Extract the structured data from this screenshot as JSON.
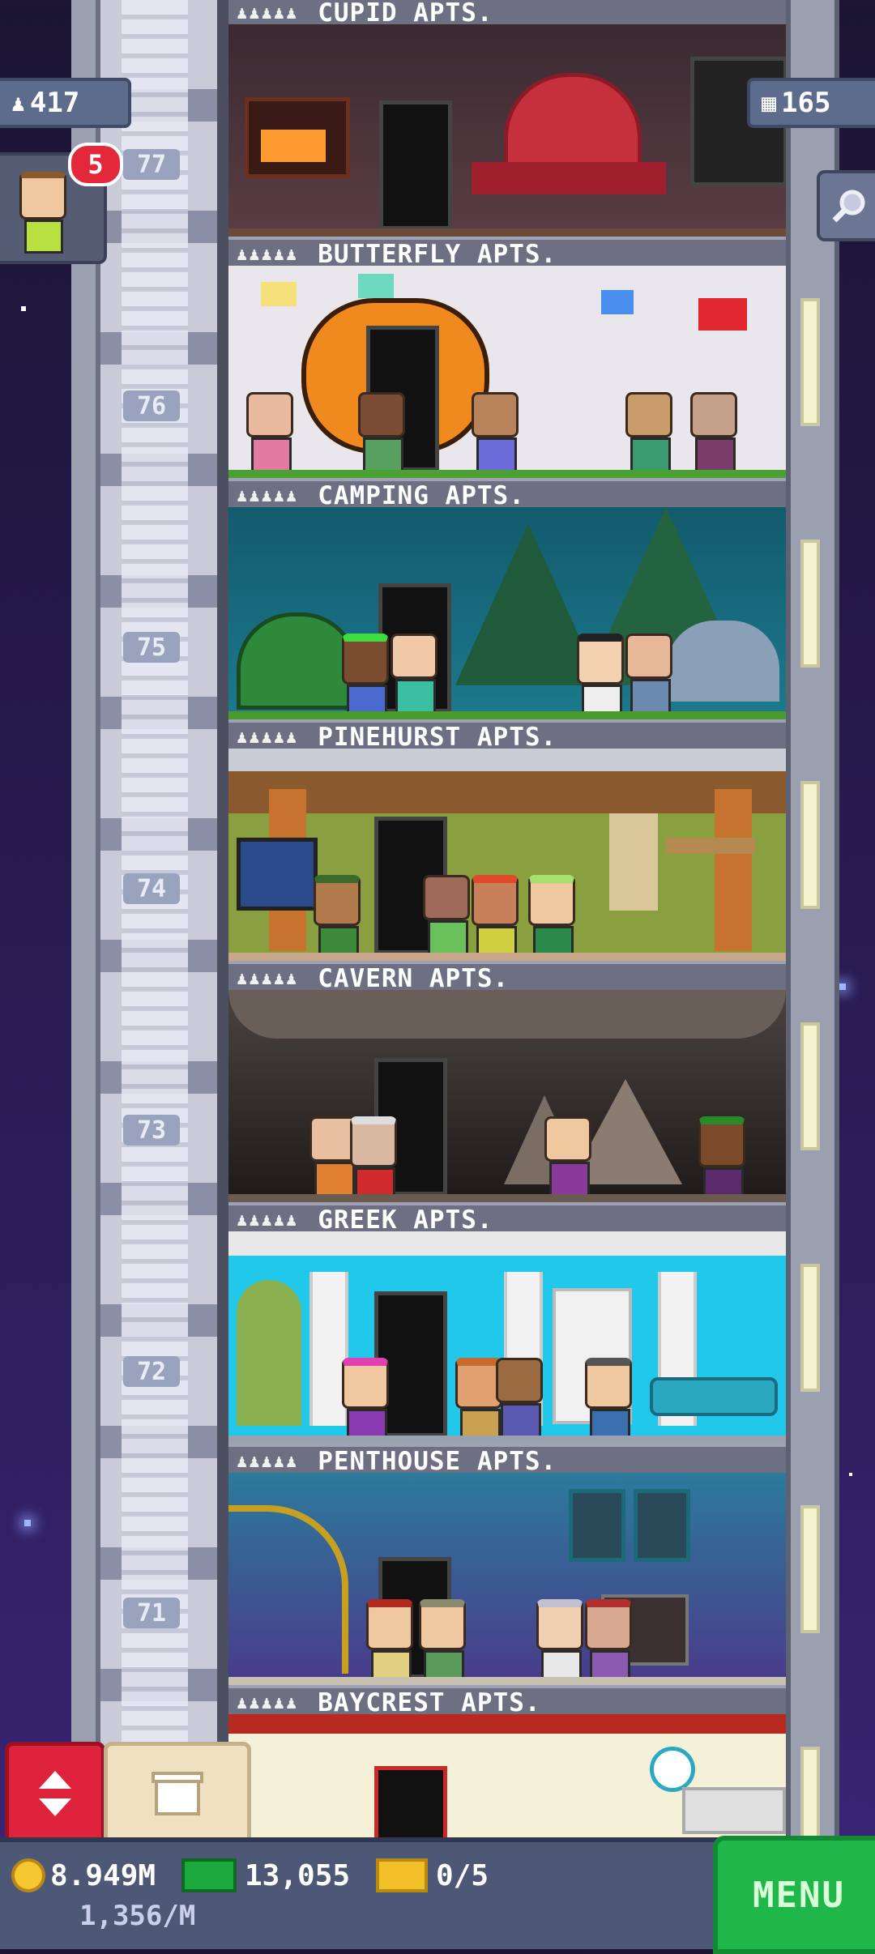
{
  "hud": {
    "population": "417",
    "floors": "165",
    "notification_count": "5"
  },
  "floors": [
    {
      "number": "77",
      "name": "CUPID APTS."
    },
    {
      "number": "76",
      "name": "BUTTERFLY APTS."
    },
    {
      "number": "75",
      "name": "CAMPING APTS."
    },
    {
      "number": "74",
      "name": "PINEHURST APTS."
    },
    {
      "number": "73",
      "name": "CAVERN APTS."
    },
    {
      "number": "72",
      "name": "GREEK APTS."
    },
    {
      "number": "71",
      "name": "PENTHOUSE APTS."
    },
    {
      "number": "",
      "name": "BAYCREST APTS."
    }
  ],
  "bottom": {
    "coins": "8.949M",
    "coin_rate": "1,356/M",
    "bux": "13,055",
    "tickets": "0/5",
    "menu_label": "MENU"
  },
  "colors": {
    "menu": "#1fb64a",
    "elevator_button": "#e0233d",
    "notification": "#e3283b"
  },
  "icons": [
    "person-icon",
    "building-icon",
    "search-icon",
    "elevator-arrows-icon",
    "build-icon",
    "coin-icon",
    "bux-icon",
    "ticket-icon"
  ]
}
